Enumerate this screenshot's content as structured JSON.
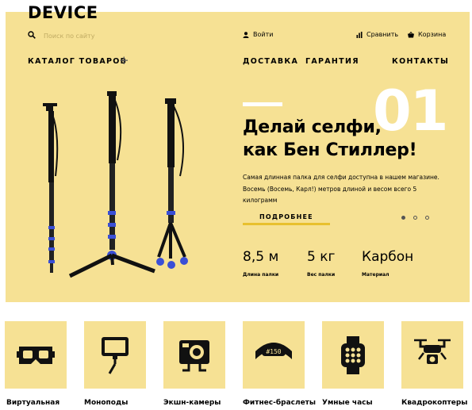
{
  "header": {
    "logo": "DEVICE",
    "search_placeholder": "Поиск по сайту",
    "login": "Войти",
    "compare": "Сравнить",
    "cart": "Корзина"
  },
  "nav": {
    "catalog": "КАТАЛОГ ТОВАРОВ",
    "catalog_icon": "plus-icon",
    "delivery": "ДОСТАВКА",
    "warranty": "ГАРАНТИЯ",
    "contacts": "КОНТАКТЫ"
  },
  "slider": {
    "number": "01",
    "title_line1": "Делай селфи,",
    "title_line2": "как Бен Стиллер!",
    "description_line1": "Самая длинная палка для селфи доступна в нашем магазине.",
    "description_line2": "Восемь (Восемь, Карл!) метров длиной и весом всего 5 килограмм",
    "more_button": "ПОДРОБНЕЕ",
    "dots": 3,
    "active_dot": 1
  },
  "specs": [
    {
      "value": "8,5 м",
      "label": "Длина палки"
    },
    {
      "value": "5 кг",
      "label": "Вес палки"
    },
    {
      "value": "Карбон",
      "label": "Материал"
    }
  ],
  "categories": [
    {
      "label": "Виртуальная",
      "icon": "vr-headset-icon"
    },
    {
      "label": "Моноподы",
      "icon": "monopod-icon"
    },
    {
      "label": "Экшн-камеры",
      "icon": "action-camera-icon"
    },
    {
      "label": "Фитнес-браслеты",
      "icon": "fitness-band-icon"
    },
    {
      "label": "Умные часы",
      "icon": "smart-watch-icon"
    },
    {
      "label": "Квадрокоптеры",
      "icon": "drone-icon"
    }
  ],
  "colors": {
    "hero_background": "#f6e194",
    "accent": "#e8c02e"
  }
}
